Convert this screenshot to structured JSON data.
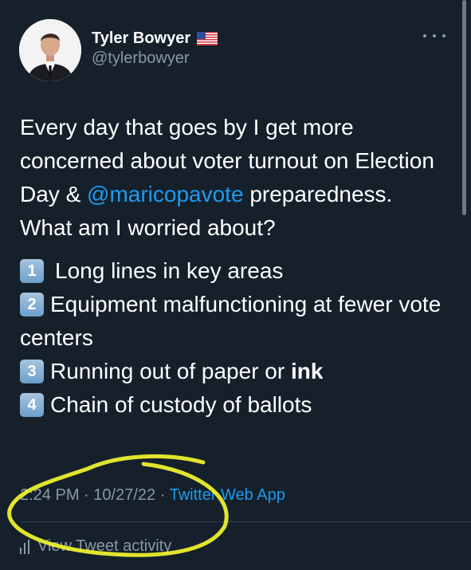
{
  "tweet": {
    "author": {
      "name": "Tyler Bowyer",
      "flag": "🇺🇸",
      "handle": "@tylerbowyer"
    },
    "text_before": "Every day that goes by I get more concerned about voter turnout on Election Day & ",
    "mention": "@maricopavote",
    "text_after": " preparedness. What am I worried about?",
    "list": [
      {
        "num": "1",
        "text": "Long lines in key areas"
      },
      {
        "num": "2",
        "text": "Equipment malfunctioning at fewer vote centers"
      },
      {
        "num": "3",
        "text": "Running out of paper or ",
        "bold": "ink"
      },
      {
        "num": "4",
        "text": "Chain of custody of ballots"
      }
    ],
    "time": "2:24 PM",
    "sep": "·",
    "date": "10/27/22",
    "source": "Twitter Web App",
    "activity_label": "View Tweet activity"
  },
  "colors": {
    "background": "#15202b",
    "link": "#1d9bf0",
    "muted": "#8b98a5",
    "highlight": "#f2f52e"
  },
  "icons": {
    "more": "more-horizontal-icon",
    "activity": "bar-chart-icon"
  }
}
